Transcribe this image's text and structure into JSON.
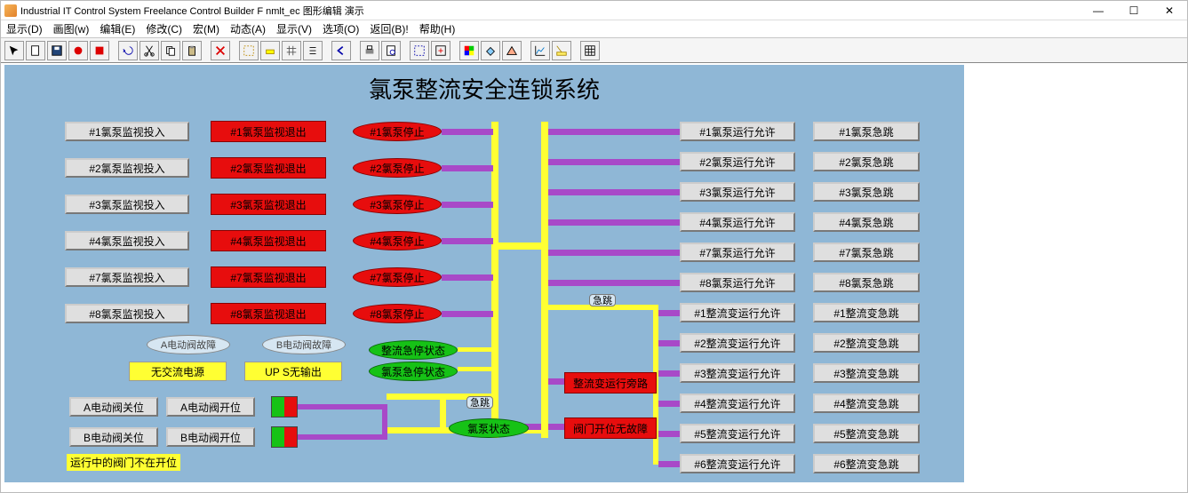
{
  "window": {
    "title": "Industrial IT Control System Freelance Control Builder F nmlt_ec 图形编辑 演示",
    "controls": {
      "min": "—",
      "max": "☐",
      "close": "✕"
    }
  },
  "menu": [
    "显示(D)",
    "画图(w)",
    "编辑(E)",
    "修改(C)",
    "宏(M)",
    "动态(A)",
    "显示(V)",
    "选项(O)",
    "返回(B)!",
    "帮助(H)"
  ],
  "scada_title": "氯泵整流安全连锁系统",
  "monitor_in": [
    "#1氯泵监视投入",
    "#2氯泵监视投入",
    "#3氯泵监视投入",
    "#4氯泵监视投入",
    "#7氯泵监视投入",
    "#8氯泵监视投入"
  ],
  "monitor_out": [
    "#1氯泵监视退出",
    "#2氯泵监视退出",
    "#3氯泵监视退出",
    "#4氯泵监视退出",
    "#7氯泵监视退出",
    "#8氯泵监视退出"
  ],
  "pump_stop": [
    "#1氯泵停止",
    "#2氯泵停止",
    "#3氯泵停止",
    "#4氯泵停止",
    "#7氯泵停止",
    "#8氯泵停止"
  ],
  "valve_fault": {
    "a": "A电动阀故障",
    "b": "B电动阀故障"
  },
  "power": {
    "ac": "无交流电源",
    "ups": "UP S无输出"
  },
  "valve_pos": {
    "a_close": "A电动阀关位",
    "a_open": "A电动阀开位",
    "b_close": "B电动阀关位",
    "b_open": "B电动阀开位"
  },
  "footer_note": "运行中的阀门不在开位",
  "status_ovals": {
    "rect_estop": "整流急停状态",
    "pump_estop": "氯泵急停状态",
    "pump_state": "氯泵状态"
  },
  "mid_btns": {
    "rect_bypass": "整流变运行旁路",
    "valve_open_ok": "阀门开位无故障"
  },
  "tiny": {
    "estop1": "急跳",
    "estop2": "急跳"
  },
  "pump_run_allow": [
    "#1氯泵运行允许",
    "#2氯泵运行允许",
    "#3氯泵运行允许",
    "#4氯泵运行允许",
    "#7氯泵运行允许",
    "#8氯泵运行允许"
  ],
  "pump_trip": [
    "#1氯泵急跳",
    "#2氯泵急跳",
    "#3氯泵急跳",
    "#4氯泵急跳",
    "#7氯泵急跳",
    "#8氯泵急跳"
  ],
  "rect_run_allow": [
    "#1整流变运行允许",
    "#2整流变运行允许",
    "#3整流变运行允许",
    "#4整流变运行允许",
    "#5整流变运行允许",
    "#6整流变运行允许"
  ],
  "rect_trip": [
    "#1整流变急跳",
    "#2整流变急跳",
    "#3整流变急跳",
    "#4整流变急跳",
    "#5整流变急跳",
    "#6整流变急跳"
  ]
}
